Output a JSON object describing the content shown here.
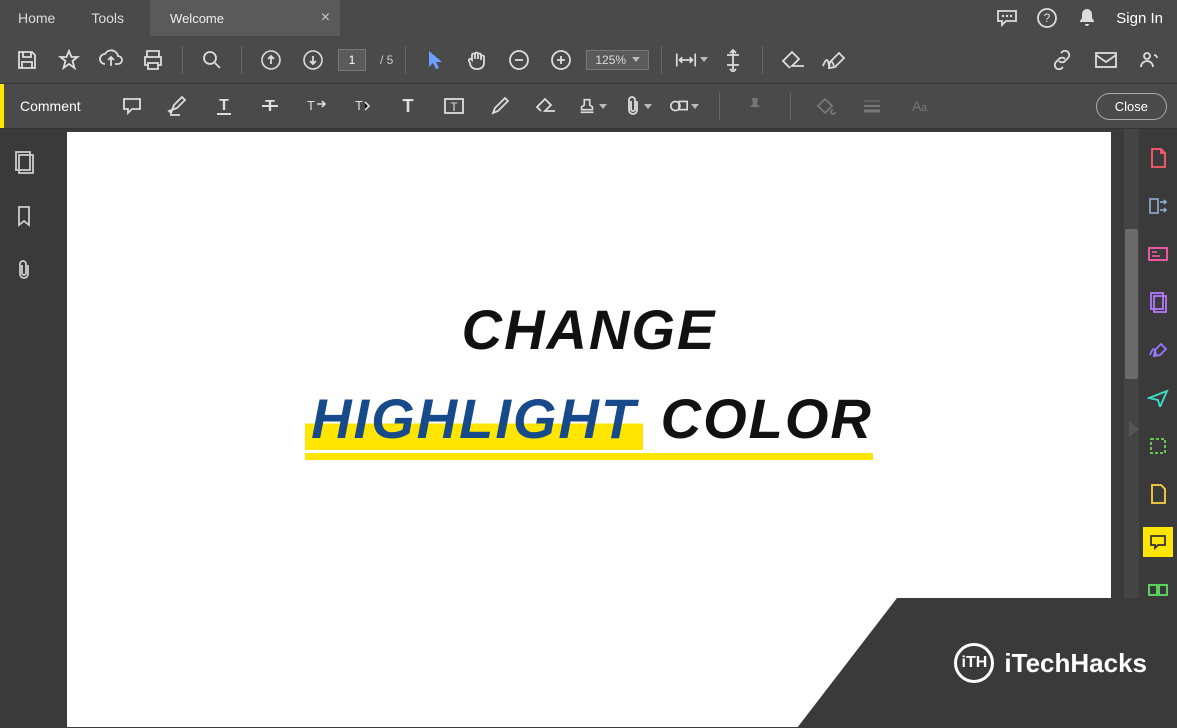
{
  "titlebar": {
    "home": "Home",
    "tools": "Tools",
    "tab": "Welcome",
    "signin": "Sign In"
  },
  "toolbar": {
    "page_current": "1",
    "page_total": "/  5",
    "zoom": "125%"
  },
  "commentbar": {
    "label": "Comment",
    "close": "Close"
  },
  "doc": {
    "line1": "CHANGE",
    "highlight": "HIGHLIGHT",
    "color": "COLOR"
  },
  "brand": {
    "logo": "iTH",
    "name": "iTechHacks"
  },
  "colors": {
    "accent": "#ffe500",
    "highlight_text": "#174a8a"
  }
}
